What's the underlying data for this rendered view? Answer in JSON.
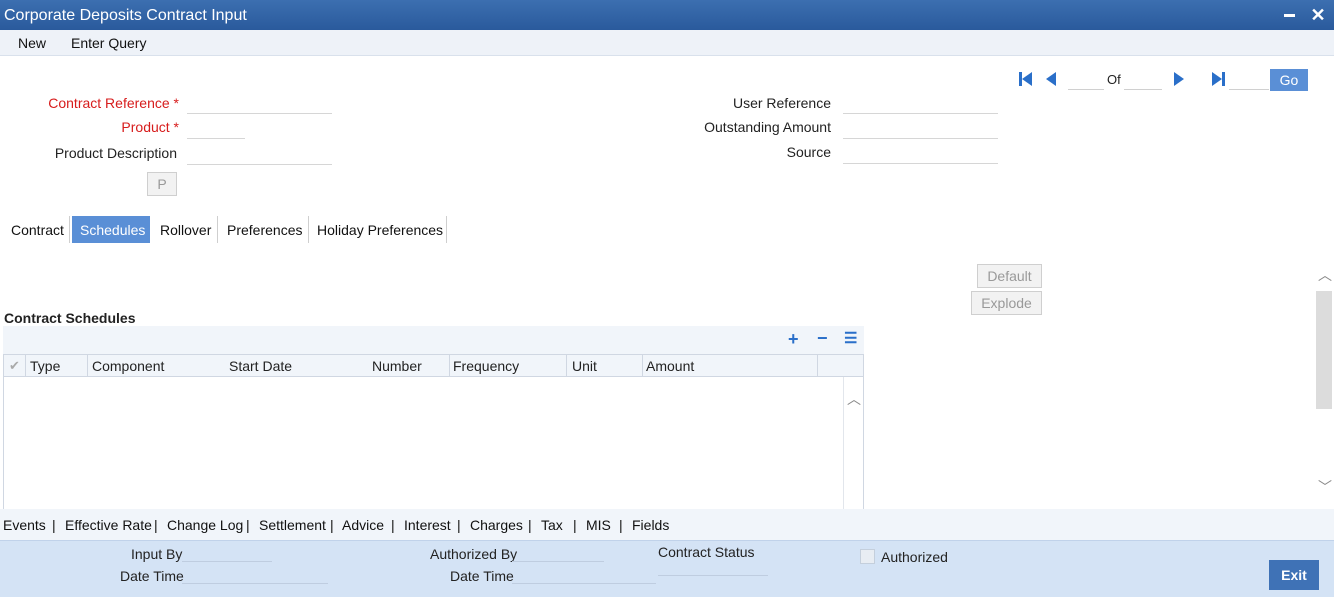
{
  "window": {
    "title": "Corporate Deposits Contract Input",
    "minimize_icon": "minimize-icon",
    "close_icon": "close-icon",
    "close_glyph": "✕"
  },
  "menu": {
    "new_label": "New",
    "enter_query_label": "Enter Query"
  },
  "navigation": {
    "of_label": "Of",
    "go_label": "Go",
    "current_page": "",
    "total_pages": "",
    "goto_page": "",
    "icons": [
      "first-record-icon",
      "previous-record-icon",
      "next-record-icon",
      "last-record-icon"
    ]
  },
  "header_fields": {
    "contract_reference": {
      "label": "Contract Reference",
      "required_mark": "*",
      "value": ""
    },
    "product": {
      "label": "Product",
      "required_mark": "*",
      "value": ""
    },
    "product_description": {
      "label": "Product Description",
      "value": ""
    },
    "p_button_label": "P",
    "user_reference": {
      "label": "User Reference",
      "value": ""
    },
    "outstanding_amount": {
      "label": "Outstanding Amount",
      "value": ""
    },
    "source": {
      "label": "Source",
      "value": ""
    }
  },
  "tabs": [
    {
      "label": "Contract",
      "active": false
    },
    {
      "label": "Schedules",
      "active": true
    },
    {
      "label": "Rollover",
      "active": false
    },
    {
      "label": "Preferences",
      "active": false
    },
    {
      "label": "Holiday Preferences",
      "active": false
    }
  ],
  "schedules": {
    "default_label": "Default",
    "explode_label": "Explode",
    "section_title": "Contract Schedules",
    "toolbar_icons": [
      "add-row-icon",
      "delete-row-icon",
      "single-view-icon"
    ],
    "columns": [
      "Type",
      "Component",
      "Start Date",
      "Number",
      "Frequency",
      "Unit",
      "Amount"
    ],
    "rows": []
  },
  "bottom_links": [
    "Events",
    "Effective Rate",
    "Change Log",
    "Settlement",
    "Advice",
    "Interest",
    "Charges",
    "Tax",
    "MIS",
    "Fields"
  ],
  "bottom_separator": "|",
  "footer": {
    "input_by_label": "Input By",
    "input_by_value": "",
    "input_date_time_label": "Date Time",
    "input_date_time_value": "",
    "authorized_by_label": "Authorized By",
    "authorized_by_value": "",
    "auth_date_time_label": "Date Time",
    "auth_date_time_value": "",
    "contract_status_label": "Contract Status",
    "contract_status_value": "",
    "authorized_label": "Authorized",
    "authorized_checked": false,
    "exit_label": "Exit"
  },
  "colors": {
    "titlebar": "#2a5a9c",
    "accent": "#5a8fd6",
    "required": "#d71c1c",
    "footer_bg": "#d4e3f5"
  }
}
